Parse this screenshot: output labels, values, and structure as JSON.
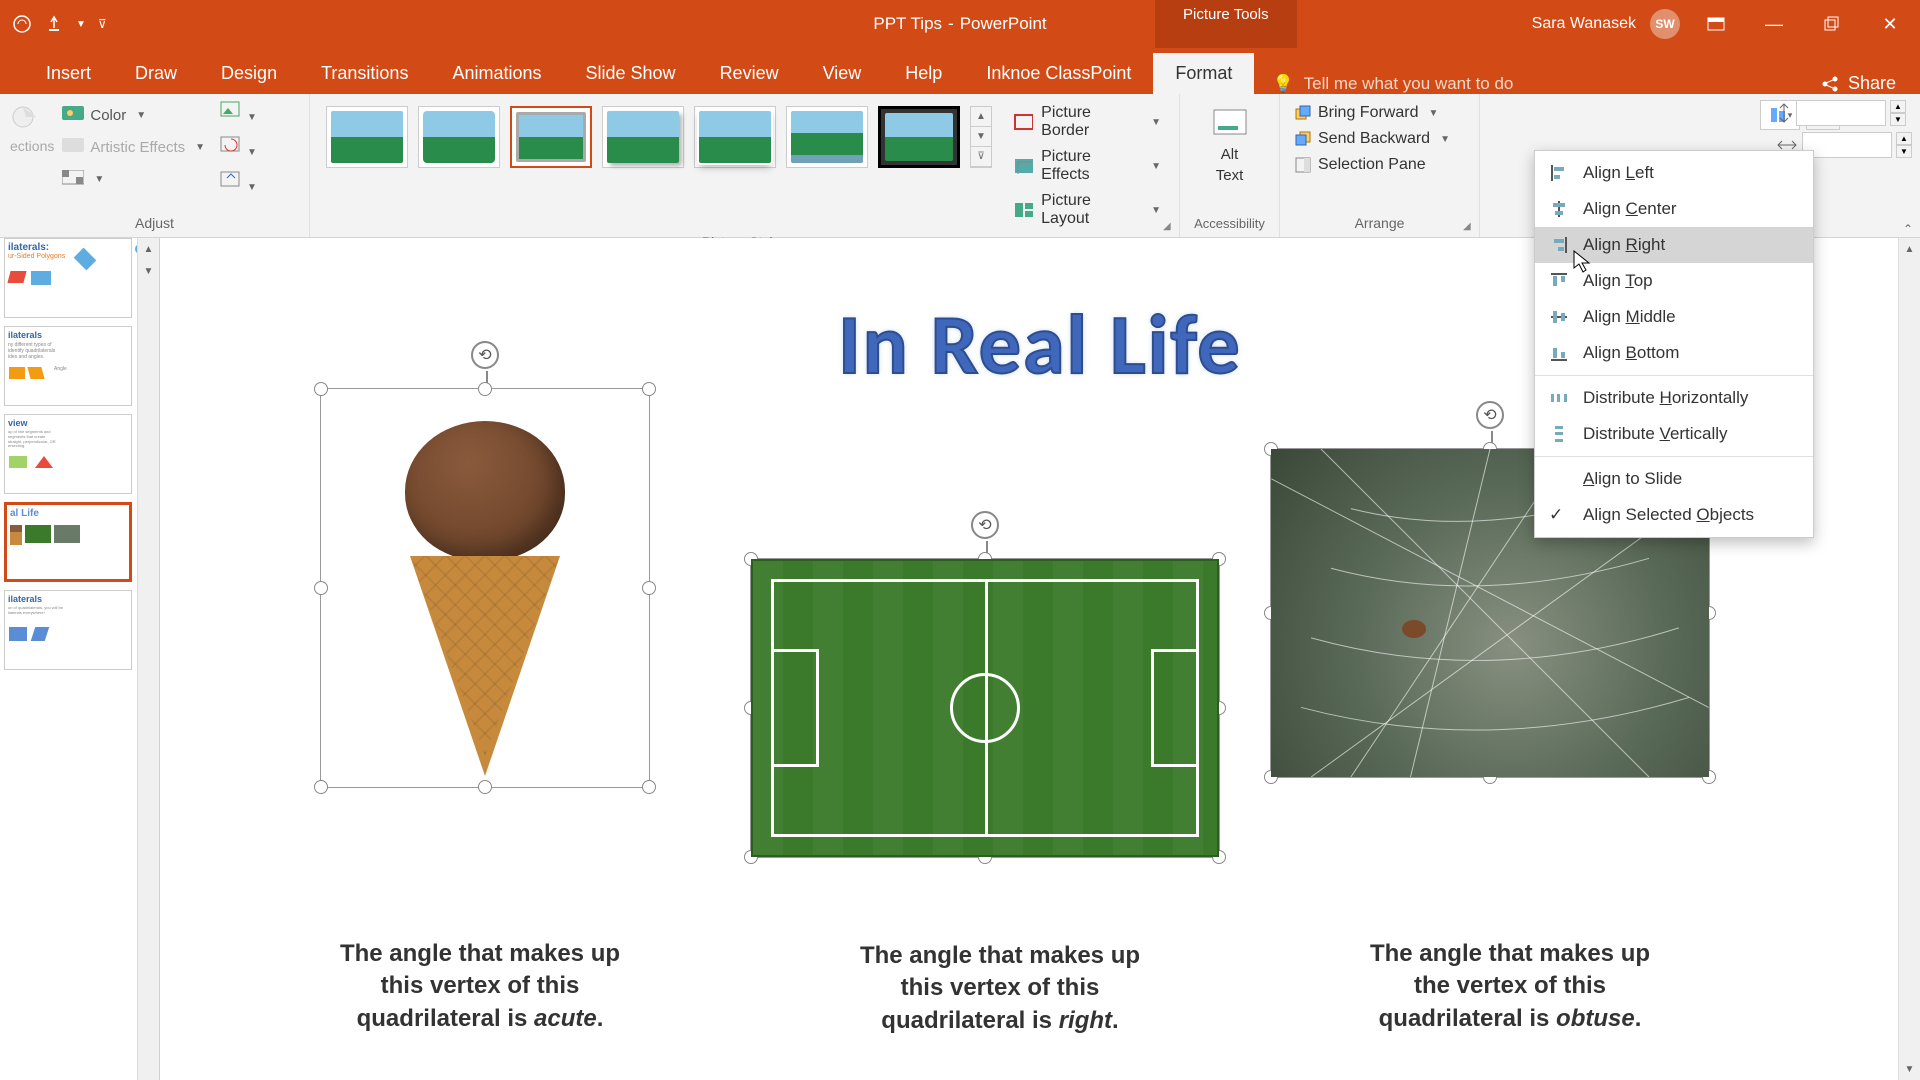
{
  "titlebar": {
    "doc_title": "PPT Tips",
    "app_name": "PowerPoint",
    "context_tab": "Picture Tools",
    "user_name": "Sara Wanasek",
    "user_initials": "SW"
  },
  "tabs": {
    "insert": "Insert",
    "draw": "Draw",
    "design": "Design",
    "transitions": "Transitions",
    "animations": "Animations",
    "slideshow": "Slide Show",
    "review": "Review",
    "view": "View",
    "help": "Help",
    "classpoint": "Inknoe ClassPoint",
    "format": "Format",
    "tellme": "Tell me what you want to do",
    "share": "Share"
  },
  "ribbon": {
    "adjust": {
      "label": "Adjust",
      "color": "Color",
      "artistic": "Artistic Effects",
      "corrections": "ections"
    },
    "picstyles": {
      "label": "Picture Styles"
    },
    "picopts": {
      "border": "Picture Border",
      "effects": "Picture Effects",
      "layout": "Picture Layout"
    },
    "accessibility": {
      "label": "Accessibility",
      "alt1": "Alt",
      "alt2": "Text"
    },
    "arrange": {
      "label": "Arrange",
      "bring_forward": "Bring Forward",
      "send_backward": "Send Backward",
      "selection_pane": "Selection Pane"
    }
  },
  "align_menu": {
    "left": "Align Left",
    "center": "Align Center",
    "right": "Align Right",
    "top": "Align Top",
    "middle": "Align Middle",
    "bottom": "Align Bottom",
    "dist_h": "Distribute Horizontally",
    "dist_v": "Distribute Vertically",
    "to_slide": "Align to Slide",
    "selected": "Align Selected Objects"
  },
  "slide": {
    "title": "In Real Life",
    "captions": {
      "c1a": "The angle that makes up",
      "c1b": "this vertex of this",
      "c1c": "quadrilateral  is ",
      "c1d": "acute",
      "c1e": ".",
      "c2a": "The angle that makes up",
      "c2b": "this vertex of this",
      "c2c": "quadrilateral  is ",
      "c2d": "right",
      "c2e": ".",
      "c3a": "The angle that makes up",
      "c3b": "the vertex of this",
      "c3c": "quadrilateral  is ",
      "c3d": "obtuse",
      "c3e": "."
    }
  },
  "thumbs": {
    "t1": "ilaterals:",
    "t1b": "ur-Sided Polygons",
    "t2": "ilaterals",
    "t3": "view",
    "t4": "al Life",
    "t5": "ilaterals"
  }
}
